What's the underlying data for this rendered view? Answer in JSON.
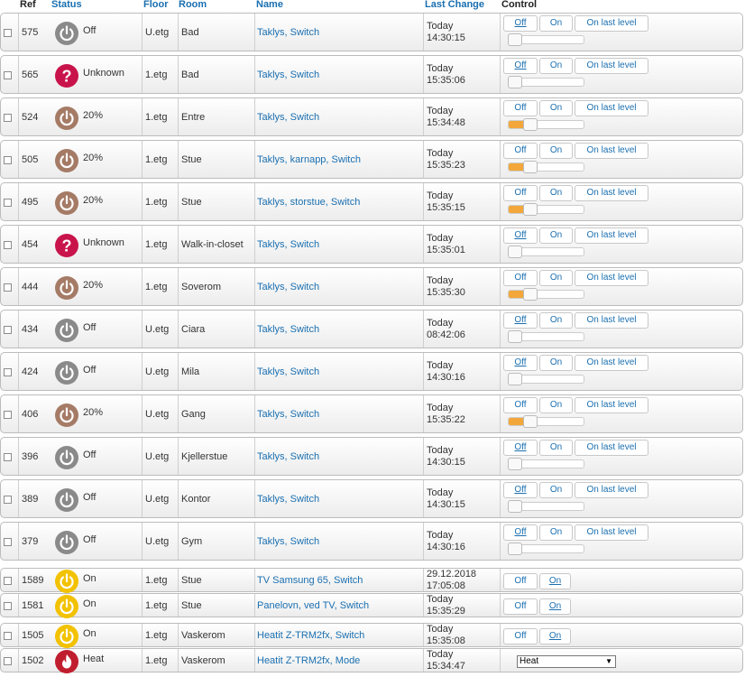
{
  "headers": {
    "ref": "Ref",
    "status": "Status",
    "floor": "Floor",
    "room": "Room",
    "name": "Name",
    "last_change": "Last Change",
    "control": "Control"
  },
  "controls": {
    "off": "Off",
    "on": "On",
    "last": "On last level"
  },
  "colors": {
    "link": "#1a6fb0",
    "off_icon": "#8a8a8a",
    "dim_icon": "#a57b66",
    "unknown_icon": "#c8144b",
    "on_icon": "#f2c200",
    "heat_icon": "#c01e2e",
    "slider_fill": "#f3a73a"
  },
  "rows": [
    {
      "ref": "575",
      "icon": "power-icon",
      "icon_color": "#8a8a8a",
      "status": "Off",
      "floor": "U.etg",
      "room": "Bad",
      "name": "Taklys, Switch",
      "date": "Today",
      "time": "14:30:15",
      "active": "off",
      "level": 0
    },
    {
      "ref": "565",
      "icon": "question-icon",
      "icon_color": "#c8144b",
      "status": "Unknown",
      "floor": "1.etg",
      "room": "Bad",
      "name": "Taklys, Switch",
      "date": "Today",
      "time": "15:35:06",
      "active": "off",
      "level": 0
    },
    {
      "ref": "524",
      "icon": "power-icon",
      "icon_color": "#a57b66",
      "status": "20%",
      "floor": "1.etg",
      "room": "Entre",
      "name": "Taklys, Switch",
      "date": "Today",
      "time": "15:34:48",
      "active": "none",
      "level": 20
    },
    {
      "ref": "505",
      "icon": "power-icon",
      "icon_color": "#a57b66",
      "status": "20%",
      "floor": "1.etg",
      "room": "Stue",
      "name": "Taklys, karnapp, Switch",
      "date": "Today",
      "time": "15:35:23",
      "active": "none",
      "level": 20
    },
    {
      "ref": "495",
      "icon": "power-icon",
      "icon_color": "#a57b66",
      "status": "20%",
      "floor": "1.etg",
      "room": "Stue",
      "name": "Taklys, storstue, Switch",
      "date": "Today",
      "time": "15:35:15",
      "active": "none",
      "level": 20
    },
    {
      "ref": "454",
      "icon": "question-icon",
      "icon_color": "#c8144b",
      "status": "Unknown",
      "floor": "1.etg",
      "room": "Walk-in-closet",
      "name": "Taklys, Switch",
      "date": "Today",
      "time": "15:35:01",
      "active": "off",
      "level": 0
    },
    {
      "ref": "444",
      "icon": "power-icon",
      "icon_color": "#a57b66",
      "status": "20%",
      "floor": "1.etg",
      "room": "Soverom",
      "name": "Taklys, Switch",
      "date": "Today",
      "time": "15:35:30",
      "active": "none",
      "level": 20
    },
    {
      "ref": "434",
      "icon": "power-icon",
      "icon_color": "#8a8a8a",
      "status": "Off",
      "floor": "U.etg",
      "room": "Ciara",
      "name": "Taklys, Switch",
      "date": "Today",
      "time": "08:42:06",
      "active": "off",
      "level": 0
    },
    {
      "ref": "424",
      "icon": "power-icon",
      "icon_color": "#8a8a8a",
      "status": "Off",
      "floor": "U.etg",
      "room": "Mila",
      "name": "Taklys, Switch",
      "date": "Today",
      "time": "14:30:16",
      "active": "off",
      "level": 0
    },
    {
      "ref": "406",
      "icon": "power-icon",
      "icon_color": "#a57b66",
      "status": "20%",
      "floor": "U.etg",
      "room": "Gang",
      "name": "Taklys, Switch",
      "date": "Today",
      "time": "15:35:22",
      "active": "none",
      "level": 20
    },
    {
      "ref": "396",
      "icon": "power-icon",
      "icon_color": "#8a8a8a",
      "status": "Off",
      "floor": "U.etg",
      "room": "Kjellerstue",
      "name": "Taklys, Switch",
      "date": "Today",
      "time": "14:30:15",
      "active": "off",
      "level": 0
    },
    {
      "ref": "389",
      "icon": "power-icon",
      "icon_color": "#8a8a8a",
      "status": "Off",
      "floor": "U.etg",
      "room": "Kontor",
      "name": "Taklys, Switch",
      "date": "Today",
      "time": "14:30:15",
      "active": "off",
      "level": 0
    },
    {
      "ref": "379",
      "icon": "power-icon",
      "icon_color": "#8a8a8a",
      "status": "Off",
      "floor": "U.etg",
      "room": "Gym",
      "name": "Taklys, Switch",
      "date": "Today",
      "time": "14:30:16",
      "active": "off",
      "level": 0
    }
  ],
  "switches": [
    {
      "ref": "1589",
      "icon": "power-icon",
      "icon_color": "#f2c200",
      "status": "On",
      "floor": "1.etg",
      "room": "Stue",
      "name": "TV Samsung 65, Switch",
      "date": "29.12.2018",
      "time": "17:05:08",
      "kind": "onoff"
    },
    {
      "ref": "1581",
      "icon": "power-icon",
      "icon_color": "#f2c200",
      "status": "On",
      "floor": "1.etg",
      "room": "Stue",
      "name": "Panelovn, ved TV, Switch",
      "date": "Today",
      "time": "15:35:29",
      "kind": "onoff"
    },
    {
      "ref": "1505",
      "icon": "power-icon",
      "icon_color": "#f2c200",
      "status": "On",
      "floor": "1.etg",
      "room": "Vaskerom",
      "name": "Heatit Z-TRM2fx, Switch",
      "date": "Today",
      "time": "15:35:08",
      "kind": "onoff"
    },
    {
      "ref": "1502",
      "icon": "flame-icon",
      "icon_color": "#c01e2e",
      "status": "Heat",
      "floor": "1.etg",
      "room": "Vaskerom",
      "name": "Heatit Z-TRM2fx, Mode",
      "date": "Today",
      "time": "15:34:47",
      "kind": "select",
      "selected": "Heat"
    }
  ]
}
